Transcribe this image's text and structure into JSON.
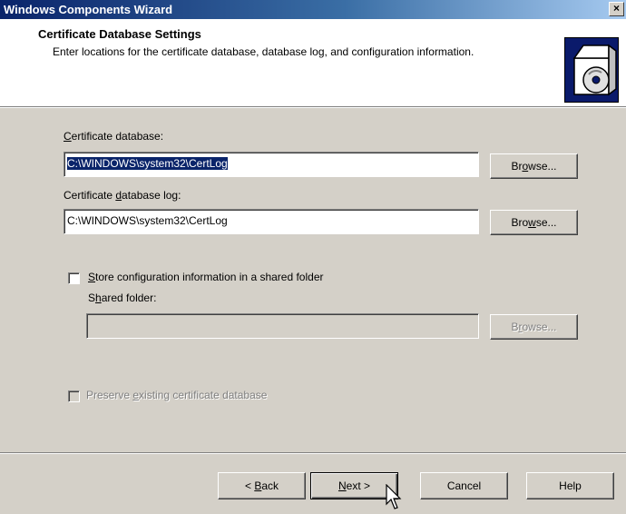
{
  "window": {
    "title": "Windows Components Wizard",
    "close_glyph": "×"
  },
  "header": {
    "title": "Certificate Database Settings",
    "description": "Enter locations for the certificate database, database log, and configuration information.",
    "icon": "cd-box-icon"
  },
  "form": {
    "cert_db_label_u": "C",
    "cert_db_label_rest": "ertificate database:",
    "cert_db_value": "C:\\WINDOWS\\system32\\CertLog",
    "cert_db_log_label_pre": "Certificate ",
    "cert_db_log_label_u": "d",
    "cert_db_log_label_rest": "atabase log:",
    "cert_db_log_value": "C:\\WINDOWS\\system32\\CertLog",
    "browse_pre": "Br",
    "browse_u": "o",
    "browse_rest": "wse...",
    "browse2_pre": "Bro",
    "browse2_u": "w",
    "browse2_rest": "se...",
    "shared_checkbox_u": "S",
    "shared_checkbox_rest": "tore configuration information in a shared folder",
    "shared_checked": false,
    "shared_folder_pre": "S",
    "shared_folder_u": "h",
    "shared_folder_rest": "ared folder:",
    "shared_folder_value": "",
    "browse3_pre": "B",
    "browse3_u": "r",
    "browse3_rest": "owse...",
    "preserve_pre": "Preserve ",
    "preserve_u": "e",
    "preserve_rest": "xisting certificate database",
    "preserve_checked": false
  },
  "footer": {
    "back_pre": "< ",
    "back_u": "B",
    "back_rest": "ack",
    "next_u": "N",
    "next_rest": "ext >",
    "cancel": "Cancel",
    "help": "Help"
  }
}
